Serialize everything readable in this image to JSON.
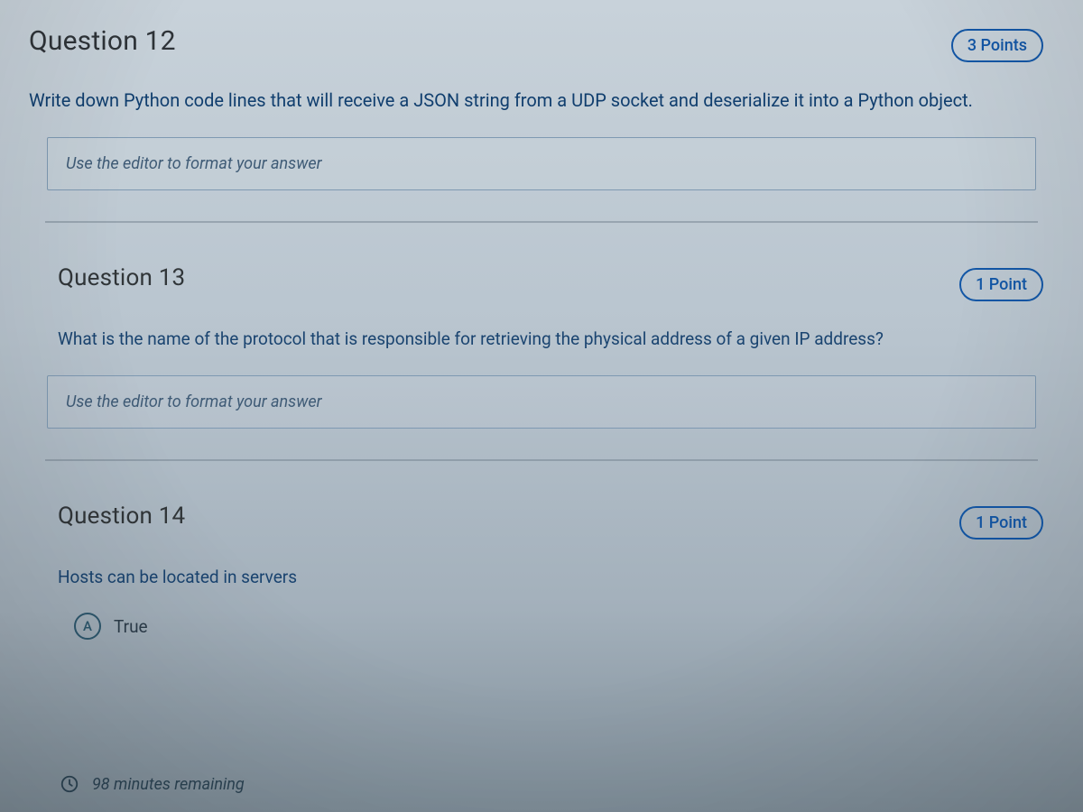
{
  "questions": [
    {
      "title": "Question 12",
      "points_label": "3 Points",
      "prompt": "Write down Python code lines that will receive a JSON string from a UDP socket and deserialize it into a Python object.",
      "answer_placeholder": "Use the editor to format your answer"
    },
    {
      "title": "Question 13",
      "points_label": "1 Point",
      "prompt": "What is the name of the protocol that is responsible for retrieving the physical address of a given IP address?",
      "answer_placeholder": "Use the editor to format your answer"
    },
    {
      "title": "Question 14",
      "points_label": "1 Point",
      "prompt": "Hosts can be located in servers",
      "option_letter": "A",
      "option_text": "True"
    }
  ],
  "footer": {
    "time_remaining": "98 minutes remaining"
  }
}
